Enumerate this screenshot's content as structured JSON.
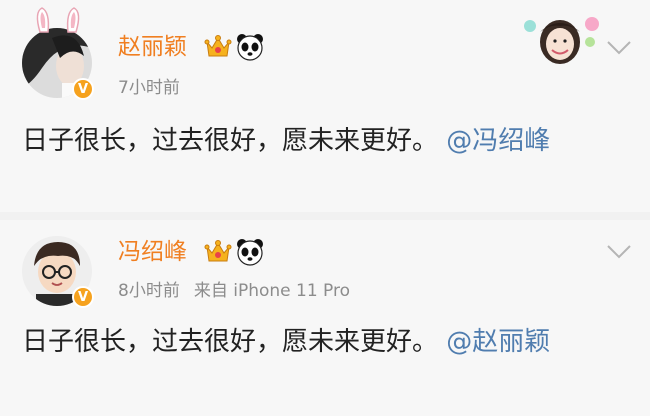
{
  "posts": [
    {
      "author": "赵丽颖",
      "time": "7小时前",
      "source": "",
      "text": "日子很长，过去很好，愿未来更好。",
      "mention": "@冯绍峰",
      "badge": "V"
    },
    {
      "author": "冯绍峰",
      "time": "8小时前",
      "source": "来自 iPhone 11 Pro",
      "text": "日子很长，过去很好，愿未来更好。",
      "mention": "@赵丽颖",
      "badge": "V"
    }
  ],
  "icons": {
    "crown": "crown-icon",
    "panda": "panda-icon",
    "chevron": "chevron-down-icon",
    "verified": "verified-badge-icon"
  },
  "colors": {
    "name": "#f07f21",
    "mention": "#507daf",
    "text": "#222222",
    "meta": "#8c8c8c",
    "badge": "#f6a21e"
  }
}
